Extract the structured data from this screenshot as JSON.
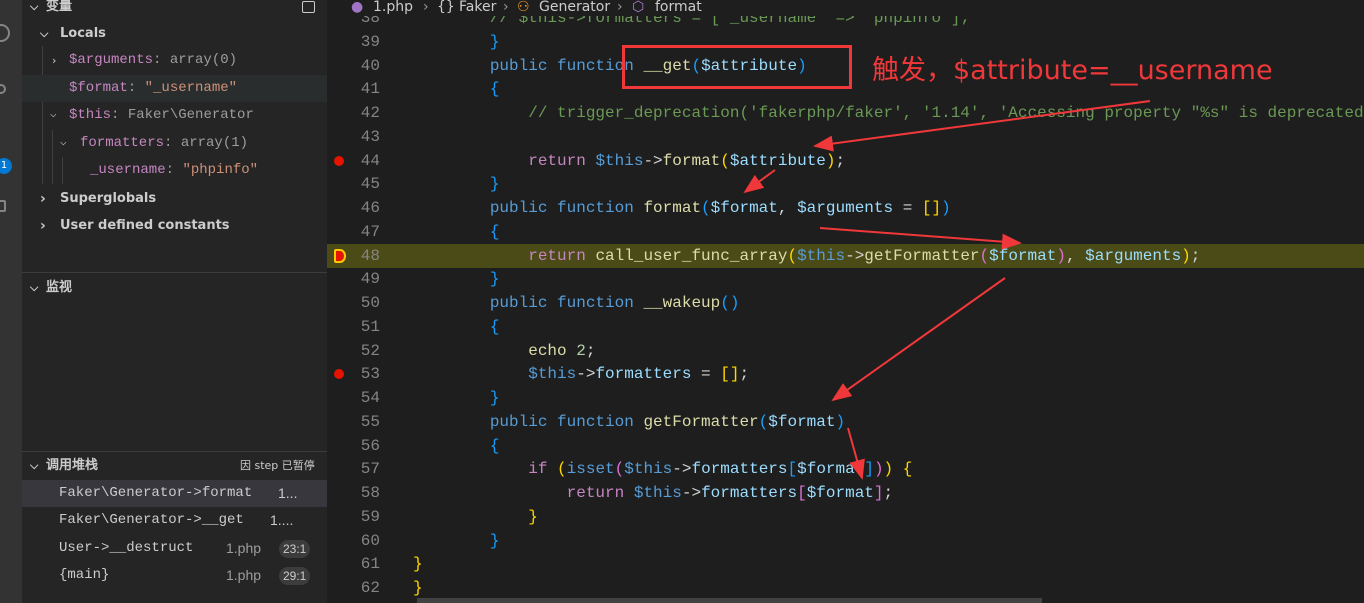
{
  "sidebar": {
    "variables_title": "变量",
    "locals": "Locals",
    "vars": [
      {
        "name": "$arguments",
        "sep": ": ",
        "value": "array(0)",
        "kind": "plain"
      },
      {
        "name": "$format",
        "sep": ": ",
        "value": "\"_username\"",
        "kind": "string"
      },
      {
        "name": "$this",
        "sep": ": ",
        "value": "Faker\\Generator",
        "kind": "plain"
      },
      {
        "name": "formatters",
        "sep": ": ",
        "value": "array(1)",
        "kind": "plain"
      },
      {
        "name": "_username",
        "sep": ": ",
        "value": "\"phpinfo\"",
        "kind": "string"
      }
    ],
    "superglobals": "Superglobals",
    "user_constants": "User defined constants",
    "watch_title": "监视",
    "callstack_title": "调用堆栈",
    "paused_status": "因 step 已暂停",
    "callstack": [
      {
        "name": "Faker\\Generator->format",
        "file": "1...",
        "pos": ""
      },
      {
        "name": "Faker\\Generator->__get",
        "file": "1....",
        "pos": ""
      },
      {
        "name": "User->__destruct",
        "file": "1.php",
        "pos": "23:1"
      },
      {
        "name": "{main}",
        "file": "1.php",
        "pos": "29:1"
      }
    ],
    "badge": "1"
  },
  "breadcrumbs": [
    "1.php",
    "Faker",
    "Generator",
    "format"
  ],
  "annotation": "触发，$attribute=__username",
  "current_line": 48,
  "breakpoints": [
    44,
    53
  ],
  "code": [
    {
      "n": "38",
      "t": [
        [
          "        ",
          "p"
        ],
        [
          "// $this->formatters = ['_username' => 'phpinfo'];",
          "c"
        ]
      ]
    },
    {
      "n": "39",
      "t": [
        [
          "        ",
          "p"
        ],
        [
          "}",
          "b3"
        ]
      ]
    },
    {
      "n": "40",
      "t": [
        [
          "        ",
          "p"
        ],
        [
          "public function ",
          "k"
        ],
        [
          "__get",
          "f"
        ],
        [
          "(",
          "b3"
        ],
        [
          "$attribute",
          "v"
        ],
        [
          ")",
          "b3"
        ]
      ]
    },
    {
      "n": "41",
      "t": [
        [
          "        ",
          "p"
        ],
        [
          "{",
          "b3"
        ]
      ]
    },
    {
      "n": "42",
      "t": [
        [
          "            ",
          "p"
        ],
        [
          "// trigger_deprecation('fakerphp/faker', '1.14', 'Accessing property \"%s\" is deprecated",
          "c"
        ]
      ]
    },
    {
      "n": "43",
      "t": []
    },
    {
      "n": "44",
      "t": [
        [
          "            ",
          "p"
        ],
        [
          "return ",
          "r"
        ],
        [
          "$this",
          "t"
        ],
        [
          "->",
          "p"
        ],
        [
          "format",
          "f"
        ],
        [
          "(",
          "b1"
        ],
        [
          "$attribute",
          "v"
        ],
        [
          ")",
          "b1"
        ],
        [
          ";",
          "p"
        ]
      ]
    },
    {
      "n": "45",
      "t": [
        [
          "        ",
          "p"
        ],
        [
          "}",
          "b3"
        ]
      ]
    },
    {
      "n": "46",
      "t": [
        [
          "        ",
          "p"
        ],
        [
          "public function ",
          "k"
        ],
        [
          "format",
          "f"
        ],
        [
          "(",
          "b3"
        ],
        [
          "$format",
          "v"
        ],
        [
          ", ",
          "p"
        ],
        [
          "$arguments",
          "v"
        ],
        [
          " = ",
          "p"
        ],
        [
          "[]",
          "b1"
        ],
        [
          ")",
          "b3"
        ]
      ]
    },
    {
      "n": "47",
      "t": [
        [
          "        ",
          "p"
        ],
        [
          "{",
          "b3"
        ]
      ]
    },
    {
      "n": "48",
      "t": [
        [
          "            ",
          "p"
        ],
        [
          "return ",
          "r"
        ],
        [
          "call_user_func_array",
          "f"
        ],
        [
          "(",
          "b1"
        ],
        [
          "$this",
          "t"
        ],
        [
          "->",
          "p"
        ],
        [
          "getFormatter",
          "f"
        ],
        [
          "(",
          "b2"
        ],
        [
          "$format",
          "v"
        ],
        [
          ")",
          "b2"
        ],
        [
          ", ",
          "p"
        ],
        [
          "$arguments",
          "v"
        ],
        [
          ")",
          "b1"
        ],
        [
          ";",
          "p"
        ]
      ]
    },
    {
      "n": "49",
      "t": [
        [
          "        ",
          "p"
        ],
        [
          "}",
          "b3"
        ]
      ]
    },
    {
      "n": "50",
      "t": [
        [
          "        ",
          "p"
        ],
        [
          "public function ",
          "k"
        ],
        [
          "__wakeup",
          "f"
        ],
        [
          "()",
          "b3"
        ]
      ]
    },
    {
      "n": "51",
      "t": [
        [
          "        ",
          "p"
        ],
        [
          "{",
          "b3"
        ]
      ]
    },
    {
      "n": "52",
      "t": [
        [
          "            ",
          "p"
        ],
        [
          "echo ",
          "f"
        ],
        [
          "2",
          "n"
        ],
        [
          ";",
          "p"
        ]
      ]
    },
    {
      "n": "53",
      "t": [
        [
          "            ",
          "p"
        ],
        [
          "$this",
          "t"
        ],
        [
          "->",
          "p"
        ],
        [
          "formatters",
          "v"
        ],
        [
          " = ",
          "p"
        ],
        [
          "[]",
          "b1"
        ],
        [
          ";",
          "p"
        ]
      ]
    },
    {
      "n": "54",
      "t": [
        [
          "        ",
          "p"
        ],
        [
          "}",
          "b3"
        ]
      ]
    },
    {
      "n": "55",
      "t": [
        [
          "        ",
          "p"
        ],
        [
          "public function ",
          "k"
        ],
        [
          "getFormatter",
          "f"
        ],
        [
          "(",
          "b3"
        ],
        [
          "$format",
          "v"
        ],
        [
          ")",
          "b3"
        ]
      ]
    },
    {
      "n": "56",
      "t": [
        [
          "        ",
          "p"
        ],
        [
          "{",
          "b3"
        ]
      ]
    },
    {
      "n": "57",
      "t": [
        [
          "            ",
          "p"
        ],
        [
          "if ",
          "r"
        ],
        [
          "(",
          "b1"
        ],
        [
          "isset",
          "k"
        ],
        [
          "(",
          "b2"
        ],
        [
          "$this",
          "t"
        ],
        [
          "->",
          "p"
        ],
        [
          "formatters",
          "v"
        ],
        [
          "[",
          "b3"
        ],
        [
          "$format",
          "v"
        ],
        [
          "]",
          "b3"
        ],
        [
          ")",
          "b2"
        ],
        [
          ")",
          "b1"
        ],
        [
          " ",
          "p"
        ],
        [
          "{",
          "b1"
        ]
      ]
    },
    {
      "n": "58",
      "t": [
        [
          "                ",
          "p"
        ],
        [
          "return ",
          "r"
        ],
        [
          "$this",
          "t"
        ],
        [
          "->",
          "p"
        ],
        [
          "formatters",
          "v"
        ],
        [
          "[",
          "b2"
        ],
        [
          "$format",
          "v"
        ],
        [
          "]",
          "b2"
        ],
        [
          ";",
          "p"
        ]
      ]
    },
    {
      "n": "59",
      "t": [
        [
          "            ",
          "p"
        ],
        [
          "}",
          "b1"
        ]
      ]
    },
    {
      "n": "60",
      "t": [
        [
          "        ",
          "p"
        ],
        [
          "}",
          "b3"
        ]
      ]
    },
    {
      "n": "61",
      "t": [
        [
          "}",
          "b1"
        ]
      ]
    },
    {
      "n": "62",
      "t": [
        [
          "}",
          "b1"
        ]
      ]
    }
  ],
  "colors": {
    "annotation": "#f0383a",
    "current_line": "#4b4b18",
    "breakpoint": "#e51400"
  }
}
